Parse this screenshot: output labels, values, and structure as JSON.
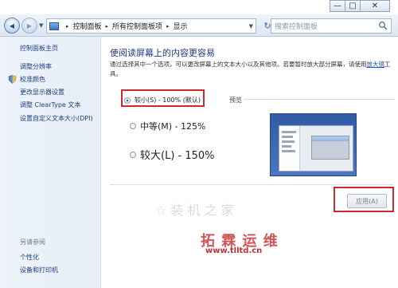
{
  "caption": {
    "minimize": "—",
    "maximize": "□",
    "close": "✕"
  },
  "nav": {
    "back_icon": "arrow-left-icon",
    "forward_icon": "arrow-right-icon",
    "back_glyph": "◀",
    "forward_glyph": "▶",
    "dropdown_glyph": "▼",
    "refresh_glyph": "↻",
    "separator_glyph": "▸"
  },
  "address": {
    "breadcrumbs": [
      "控制面板",
      "所有控制面板项",
      "显示"
    ]
  },
  "search": {
    "placeholder": "搜索控制面板"
  },
  "sidebar": {
    "home": "控制面板主页",
    "items": [
      "调整分辨率",
      "校准颜色",
      "更改显示器设置",
      "调整 ClearType 文本",
      "设置自定义文本大小(DPI)"
    ],
    "see_also_title": "另请参阅",
    "see_also": [
      "个性化",
      "设备和打印机"
    ]
  },
  "main": {
    "headline": "使阅读屏幕上的内容更容易",
    "description_pre": "通过选择其中一个选项，可以更改屏幕上的文本大小以及其他项。若要暂时放大部分屏幕，请使用",
    "description_link": "放大镜",
    "description_post": "工具。",
    "options": [
      {
        "label": "较小(S) - 100% (默认)",
        "checked": true
      },
      {
        "label": "中等(M) - 125%",
        "checked": false
      },
      {
        "label": "较大(L) - 150%",
        "checked": false
      }
    ],
    "preview_label": "预览",
    "apply_label": "应用(A)"
  },
  "watermark": {
    "text": "拓 霖 运 维",
    "url": "www.tlltd.cn",
    "faint": "☆ 装 机 之 家"
  },
  "colors": {
    "accent": "#1f3a8a",
    "highlight": "#cc2b2b",
    "link": "#1a4fb5"
  }
}
